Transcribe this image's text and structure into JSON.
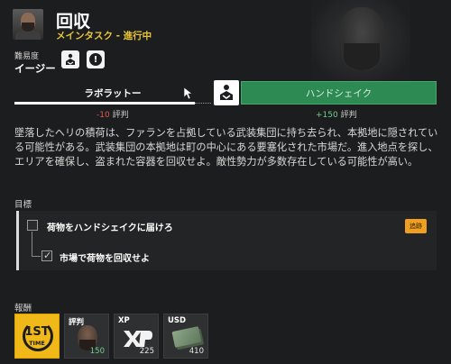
{
  "mission": {
    "title": "回収",
    "subtitle": "メインタスク - 進行中",
    "difficulty_label": "難易度",
    "difficulty_value": "イージー",
    "difficulty_icon_2": "!"
  },
  "choice": {
    "left_label": "ラボラットー",
    "right_label": "ハンドシェイク",
    "left_rep_value": "-10",
    "left_rep_label": "評判",
    "right_rep_value": "+150",
    "right_rep_label": "評判"
  },
  "description": "墜落したヘリの積荷は、ファランを占拠している武装集団に持ち去られ、本拠地に隠されている可能性がある。武装集団の本拠地は町の中心にある要塞化された市場だ。進入地点を探し、エリアを確保し、盗まれた容器を回収せよ。敵性勢力が多数存在している可能性が高い。",
  "objectives": {
    "header": "目標",
    "items": [
      {
        "label": "荷物をハンドシェイクに届けろ",
        "checked": false
      },
      {
        "label": "市場で荷物を回収せよ",
        "checked": true
      }
    ],
    "track_button": "追跡"
  },
  "rewards": {
    "header": "報酬",
    "first_time_top": "1ST",
    "first_time_bottom": "TIME",
    "items": [
      {
        "label": "評判",
        "value": "150"
      },
      {
        "label": "XP",
        "value": "225"
      },
      {
        "label": "USD",
        "value": "410"
      }
    ]
  },
  "colors": {
    "accent_green": "#2d8a53",
    "accent_yellow": "#e8c43a",
    "negative": "#e05a4f",
    "positive": "#6fcf8e",
    "track_orange": "#f0a020"
  }
}
